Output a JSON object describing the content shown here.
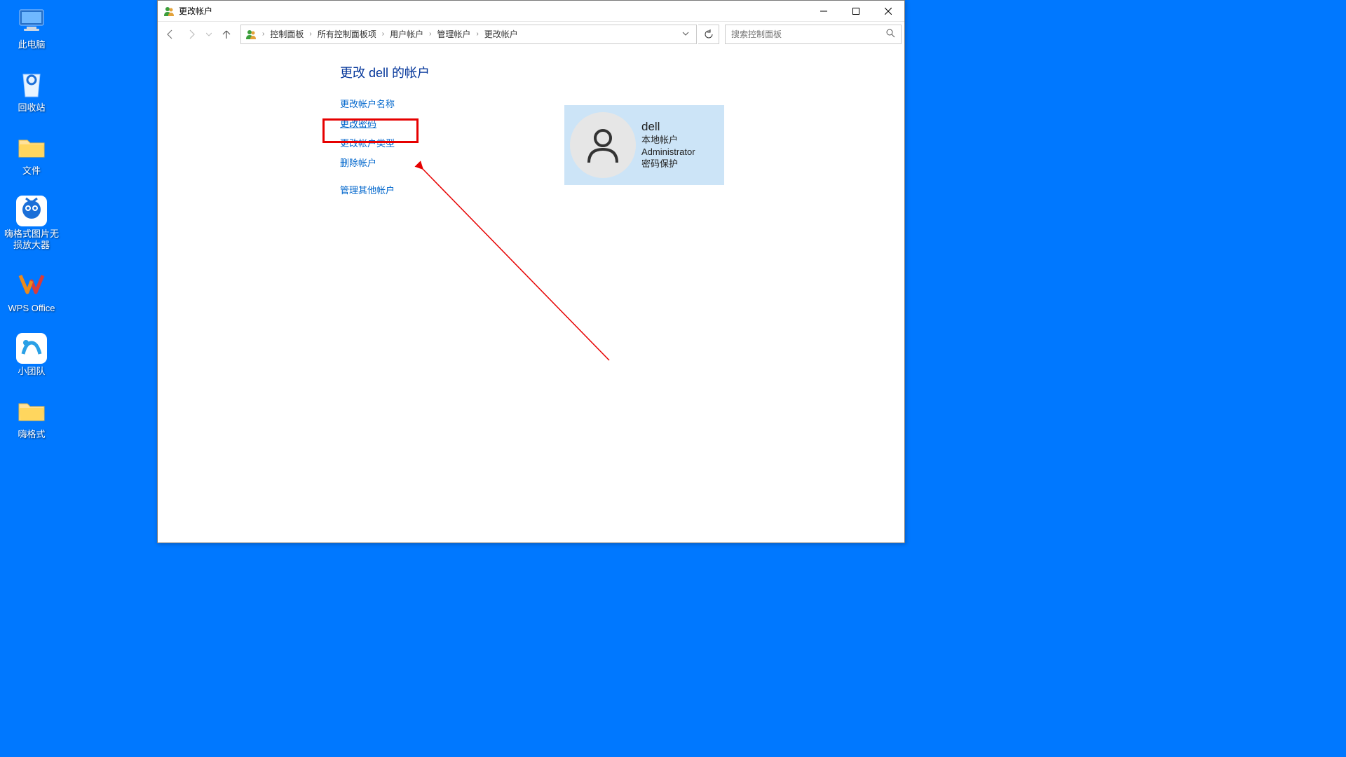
{
  "desktop": {
    "icons": [
      {
        "name": "此电脑"
      },
      {
        "name": "回收站"
      },
      {
        "name": "文件"
      },
      {
        "name": "嗨格式图片无\n损放大器"
      },
      {
        "name": "WPS Office"
      },
      {
        "name": "小团队"
      },
      {
        "name": "嗨格式"
      }
    ]
  },
  "window": {
    "title": "更改帐户",
    "breadcrumb": [
      "控制面板",
      "所有控制面板项",
      "用户帐户",
      "管理帐户",
      "更改帐户"
    ],
    "search_placeholder": "搜索控制面板"
  },
  "page": {
    "title": "更改 dell 的帐户",
    "actions": [
      "更改帐户名称",
      "更改密码",
      "更改帐户类型",
      "删除帐户"
    ],
    "other_action": "管理其他帐户"
  },
  "user": {
    "name": "dell",
    "account_type": "本地帐户",
    "role": "Administrator",
    "protection": "密码保护"
  }
}
